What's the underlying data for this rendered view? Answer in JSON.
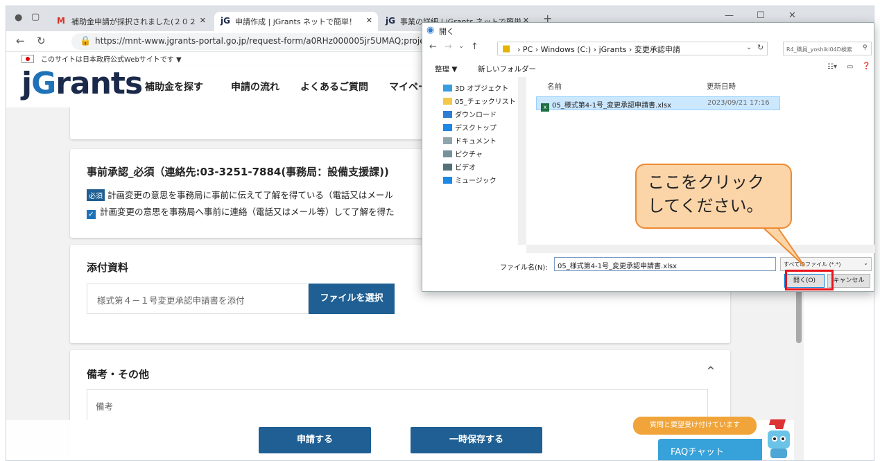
{
  "browser": {
    "tabs": [
      {
        "icon": "M",
        "title": "補助金申請が採択されました(２０２"
      },
      {
        "icon": "jG",
        "title": "申請作成 | jGrants ネットで簡単！"
      },
      {
        "icon": "jG",
        "title": "事業の詳細 | jGrants ネットで簡単"
      }
    ],
    "new_tab": "+",
    "url": "https://mnt-www.jgrants-portal.go.jp/request-form/a0RHz000005jr5UMAQ;proje"
  },
  "site": {
    "gov_notice": "このサイトは日本政府公式Webサイトです ▼",
    "logo_prefix": "j",
    "logo_g": "G",
    "logo_rest": "rants",
    "nav": [
      "補助金を探す",
      "申請の流れ",
      "よくあるご質問",
      "マイペー"
    ]
  },
  "form": {
    "approval": {
      "title": "事前承認_必須（連絡先:03-3251-7884(事務局：設備支援課))",
      "required_badge": "必須",
      "requirement_text": "計画変更の意思を事務局に事前に伝えて了解を得ている（電話又はメール",
      "checkbox_label": "計画変更の意思を事務局へ事前に連絡（電話又はメール等）して了解を得た"
    },
    "attachment": {
      "title": "添付資料",
      "placeholder": "様式第４－１号変更承認申請書を添付",
      "choose_button": "ファイルを選択"
    },
    "remarks": {
      "title": "備考・その他",
      "collapse_icon": "^",
      "placeholder": "備考"
    },
    "submit_button": "申請する",
    "save_button": "一時保存する"
  },
  "faq": {
    "bubble": "質問と要望受け付けています",
    "button": "FAQチャット"
  },
  "dialog": {
    "title": "開く",
    "breadcrumb": "›  PC  ›  Windows (C:)  ›  jGrants  ›  変更承認申請",
    "search_placeholder": "R4_職員_yoshiki04D検索",
    "organize": "整理 ▼",
    "new_folder": "新しいフォルダー",
    "tree": [
      "3D オブジェクト",
      "05_チェックリスト",
      "ダウンロード",
      "デスクトップ",
      "ドキュメント",
      "ピクチャ",
      "ビデオ",
      "ミュージック"
    ],
    "col_name": "名前",
    "col_date": "更新日時",
    "file": {
      "name": "05_様式第4-1号_変更承認申請書.xlsx",
      "date": "2023/09/21 17:16"
    },
    "filename_label": "ファイル名(N):",
    "filename_value": "05_様式第4-1号_変更承認申請書.xlsx",
    "filetype": "すべてのファイル (*.*)",
    "open_button": "開く(O)",
    "cancel_button": "キャンセル"
  },
  "callout": {
    "line1": "ここをクリック",
    "line2": "してください。"
  },
  "colors": {
    "primary": "#1f5f93",
    "callout_fill": "#fbd5a8",
    "callout_border": "#ee8a33",
    "highlight": "#e8141b",
    "faq": "#37a1d9"
  }
}
